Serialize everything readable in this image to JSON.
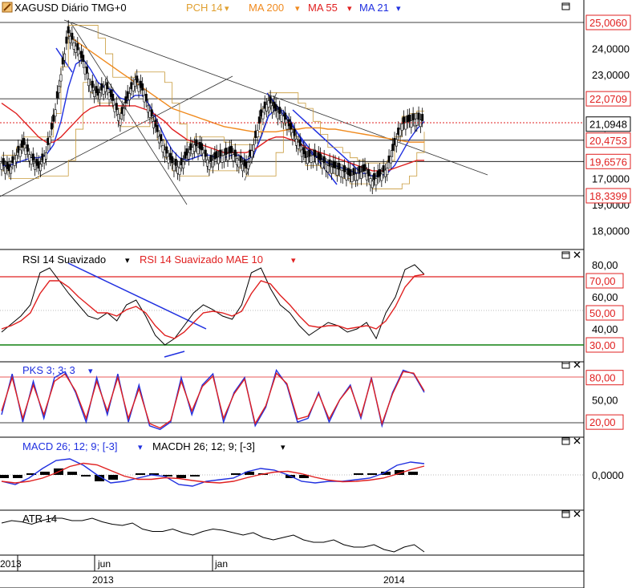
{
  "main_panel": {
    "title": "XAGUSD Diário TMG+0",
    "indicators": [
      {
        "label": "PCH 14",
        "color": "#e0a030"
      },
      {
        "label": "MA 200",
        "color": "#f08a1e"
      },
      {
        "label": "MA 55",
        "color": "#e02020"
      },
      {
        "label": "MA 21",
        "color": "#2030e0"
      }
    ],
    "price_ticks": [
      "24,0000",
      "23,0000",
      "21,0000",
      "19,0000",
      "18,0000",
      "17,0000"
    ],
    "level_labels": [
      "25,0060",
      "22,0709",
      "20,4753",
      "19,6576",
      "18,3399"
    ],
    "last_price": "21,0948"
  },
  "rsi_panel": {
    "title": "RSI 14 Suavizado",
    "title2": "RSI 14 Suavizado MAE 10",
    "ticks": [
      "80,00",
      "60,00",
      "40,00"
    ],
    "levels": [
      "70,00",
      "50,00",
      "30,00"
    ]
  },
  "pks_panel": {
    "title": "PKS 3; 3; 3",
    "ticks": [
      "50,00"
    ],
    "levels": [
      "80,00",
      "20,00"
    ]
  },
  "macd_panel": {
    "title": "MACD 26; 12; 9; [-3]",
    "title2": "MACDH 26; 12; 9; [-3]",
    "ticks": [
      "0,0000"
    ]
  },
  "atr_panel": {
    "title": "ATR 14"
  },
  "time_axis": {
    "months": [
      "2013",
      "jun",
      "jan"
    ],
    "years": [
      "2013",
      "2014"
    ]
  },
  "colors": {
    "candle": "#000000",
    "ma21": "#2030e0",
    "ma55": "#e02020",
    "ma200": "#f08a1e",
    "pch": "#c89a3a",
    "level_line": "#e02020",
    "support_line": "#108010"
  },
  "chart_data": [
    {
      "type": "line",
      "title": "XAGUSD Diário TMG+0",
      "ylim": [
        16.3,
        25.5
      ],
      "y_ticks": [
        17,
        18,
        19,
        21,
        23,
        24
      ],
      "horizontal_levels": [
        25.006,
        22.0709,
        20.4753,
        19.6576,
        18.3399
      ],
      "last_value": 21.0948,
      "series": [
        {
          "name": "XAGUSD",
          "values": [
            19.6,
            19.3,
            19.9,
            20.3,
            19.8,
            19.4,
            20.0,
            21.2,
            23.0,
            24.6,
            24.1,
            23.5,
            22.6,
            22.2,
            22.6,
            22.0,
            21.3,
            22.1,
            22.8,
            22.4,
            21.6,
            20.8,
            20.1,
            19.6,
            19.4,
            19.9,
            20.3,
            20.1,
            19.6,
            19.8,
            19.9,
            20.0,
            19.7,
            19.4,
            20.3,
            21.4,
            22.0,
            21.6,
            21.4,
            20.9,
            20.4,
            19.8,
            19.9,
            19.7,
            19.5,
            19.4,
            19.3,
            19.1,
            19.2,
            19.3,
            18.9,
            19.1,
            19.4,
            20.3,
            21.1,
            21.2,
            21.3,
            21.2
          ]
        },
        {
          "name": "MA 21",
          "values": [
            19.5,
            19.5,
            19.6,
            19.7,
            19.8,
            19.8,
            19.9,
            20.3,
            21.2,
            22.5,
            23.4,
            23.6,
            23.2,
            22.7,
            22.5,
            22.4,
            22.1,
            22.0,
            22.2,
            22.2,
            21.8,
            21.2,
            20.6,
            20.1,
            19.8,
            19.7,
            19.8,
            19.9,
            19.9,
            19.8,
            19.8,
            19.9,
            19.9,
            19.7,
            19.9,
            20.6,
            21.4,
            21.7,
            21.6,
            21.2,
            20.7,
            20.2,
            19.9,
            19.8,
            19.6,
            19.5,
            19.4,
            19.3,
            19.2,
            19.2,
            19.1,
            19.1,
            19.2,
            19.5,
            20.0,
            20.5,
            20.9,
            21.2
          ]
        },
        {
          "name": "MA 55",
          "values": [
            21.9,
            21.7,
            21.5,
            21.2,
            20.9,
            20.6,
            20.4,
            20.4,
            20.6,
            20.9,
            21.2,
            21.5,
            21.7,
            21.8,
            21.8,
            21.8,
            21.8,
            21.8,
            21.8,
            21.7,
            21.6,
            21.4,
            21.2,
            20.9,
            20.7,
            20.5,
            20.4,
            20.3,
            20.2,
            20.1,
            20.0,
            20.0,
            20.0,
            20.0,
            20.1,
            20.3,
            20.5,
            20.6,
            20.6,
            20.5,
            20.4,
            20.2,
            20.1,
            20.0,
            19.9,
            19.8,
            19.7,
            19.6,
            19.5,
            19.4,
            19.3,
            19.3,
            19.3,
            19.4,
            19.5,
            19.6,
            19.7,
            19.7
          ]
        },
        {
          "name": "MA 200",
          "values": [
            null,
            null,
            null,
            null,
            null,
            null,
            null,
            null,
            null,
            24.5,
            24.3,
            24.1,
            23.9,
            23.7,
            23.5,
            23.3,
            23.1,
            22.9,
            22.7,
            22.5,
            22.3,
            22.1,
            21.9,
            21.7,
            21.6,
            21.5,
            21.4,
            21.3,
            21.2,
            21.1,
            21.0,
            20.95,
            20.9,
            20.85,
            20.8,
            20.8,
            20.8,
            20.8,
            20.85,
            20.9,
            20.9,
            20.95,
            20.95,
            20.95,
            20.9,
            20.9,
            20.85,
            20.8,
            20.75,
            20.7,
            20.65,
            20.6,
            20.55,
            20.5,
            20.45,
            20.4,
            20.4,
            20.4
          ]
        }
      ]
    },
    {
      "type": "line",
      "title": "RSI 14 Suavizado",
      "ylim": [
        22,
        84
      ],
      "y_ticks": [
        40,
        60,
        80
      ],
      "levels": [
        70,
        50,
        30
      ],
      "series": [
        {
          "name": "RSI 14 Suavizado",
          "values": [
            38,
            43,
            48,
            55,
            75,
            78,
            70,
            62,
            55,
            48,
            46,
            50,
            45,
            55,
            58,
            48,
            36,
            30,
            34,
            42,
            50,
            55,
            52,
            48,
            46,
            55,
            75,
            78,
            65,
            55,
            50,
            42,
            36,
            40,
            44,
            42,
            38,
            40,
            44,
            34,
            50,
            60,
            77,
            80,
            74
          ]
        },
        {
          "name": "RSI 14 Suavizado MAE 10",
          "values": [
            40,
            42,
            45,
            50,
            62,
            70,
            70,
            66,
            60,
            55,
            50,
            50,
            48,
            52,
            54,
            50,
            42,
            36,
            34,
            38,
            44,
            50,
            51,
            50,
            48,
            51,
            62,
            70,
            68,
            61,
            55,
            48,
            42,
            41,
            42,
            42,
            40,
            41,
            42,
            40,
            45,
            54,
            66,
            73,
            74
          ]
        }
      ]
    },
    {
      "type": "line",
      "title": "PKS 3; 3; 3",
      "ylim": [
        5,
        97
      ],
      "y_ticks": [
        50
      ],
      "levels": [
        80,
        20
      ],
      "series": [
        {
          "name": "PKS 3; 3; 3",
          "values": [
            30,
            85,
            20,
            75,
            25,
            80,
            88,
            60,
            20,
            80,
            30,
            85,
            20,
            70,
            15,
            10,
            20,
            80,
            30,
            70,
            85,
            20,
            60,
            80,
            15,
            40,
            90,
            70,
            20,
            25,
            60,
            20,
            50,
            70,
            25,
            80,
            15,
            60,
            90,
            85,
            60
          ]
        },
        {
          "name": "PKS signal",
          "values": [
            35,
            80,
            25,
            70,
            30,
            75,
            85,
            62,
            25,
            75,
            35,
            80,
            25,
            65,
            18,
            12,
            22,
            75,
            35,
            68,
            82,
            25,
            58,
            78,
            18,
            42,
            86,
            72,
            24,
            28,
            58,
            24,
            50,
            68,
            28,
            78,
            18,
            58,
            88,
            86,
            62
          ]
        }
      ]
    },
    {
      "type": "line",
      "title": "MACD 26; 12; 9; [-3]",
      "y_ticks": [
        0
      ],
      "series": [
        {
          "name": "MACD 26; 12; 9; [-3]",
          "values": [
            -0.2,
            -0.3,
            -0.1,
            0.2,
            0.45,
            0.5,
            0.3,
            0.0,
            -0.25,
            -0.2,
            -0.1,
            0.0,
            -0.05,
            -0.3,
            -0.35,
            -0.2,
            -0.15,
            -0.1,
            0.1,
            0.2,
            0.15,
            0.0,
            -0.2,
            -0.25,
            -0.2,
            -0.2,
            -0.15,
            -0.1,
            0.05,
            0.3,
            0.4,
            0.35
          ]
        },
        {
          "name": "MACDH 26; 12; 9; [-3]",
          "values": [
            -0.1,
            -0.1,
            0.05,
            0.1,
            0.2,
            0.1,
            -0.05,
            -0.2,
            -0.15,
            0.0,
            0.05,
            0.05,
            -0.05,
            -0.1,
            -0.05,
            0.0,
            0.0,
            0.05,
            0.1,
            0.05,
            0.0,
            -0.1,
            -0.1,
            0.0,
            0.0,
            0.0,
            0.05,
            0.05,
            0.1,
            0.15,
            0.1,
            0.0
          ]
        }
      ]
    },
    {
      "type": "line",
      "title": "ATR 14",
      "series": [
        {
          "name": "ATR 14",
          "values": [
            0.62,
            0.63,
            0.64,
            0.66,
            0.64,
            0.63,
            0.6,
            0.57,
            0.55,
            0.54,
            0.55,
            0.56,
            0.52,
            0.5,
            0.5,
            0.48,
            0.46,
            0.44,
            0.42,
            0.4,
            0.42,
            0.38
          ]
        }
      ]
    }
  ]
}
